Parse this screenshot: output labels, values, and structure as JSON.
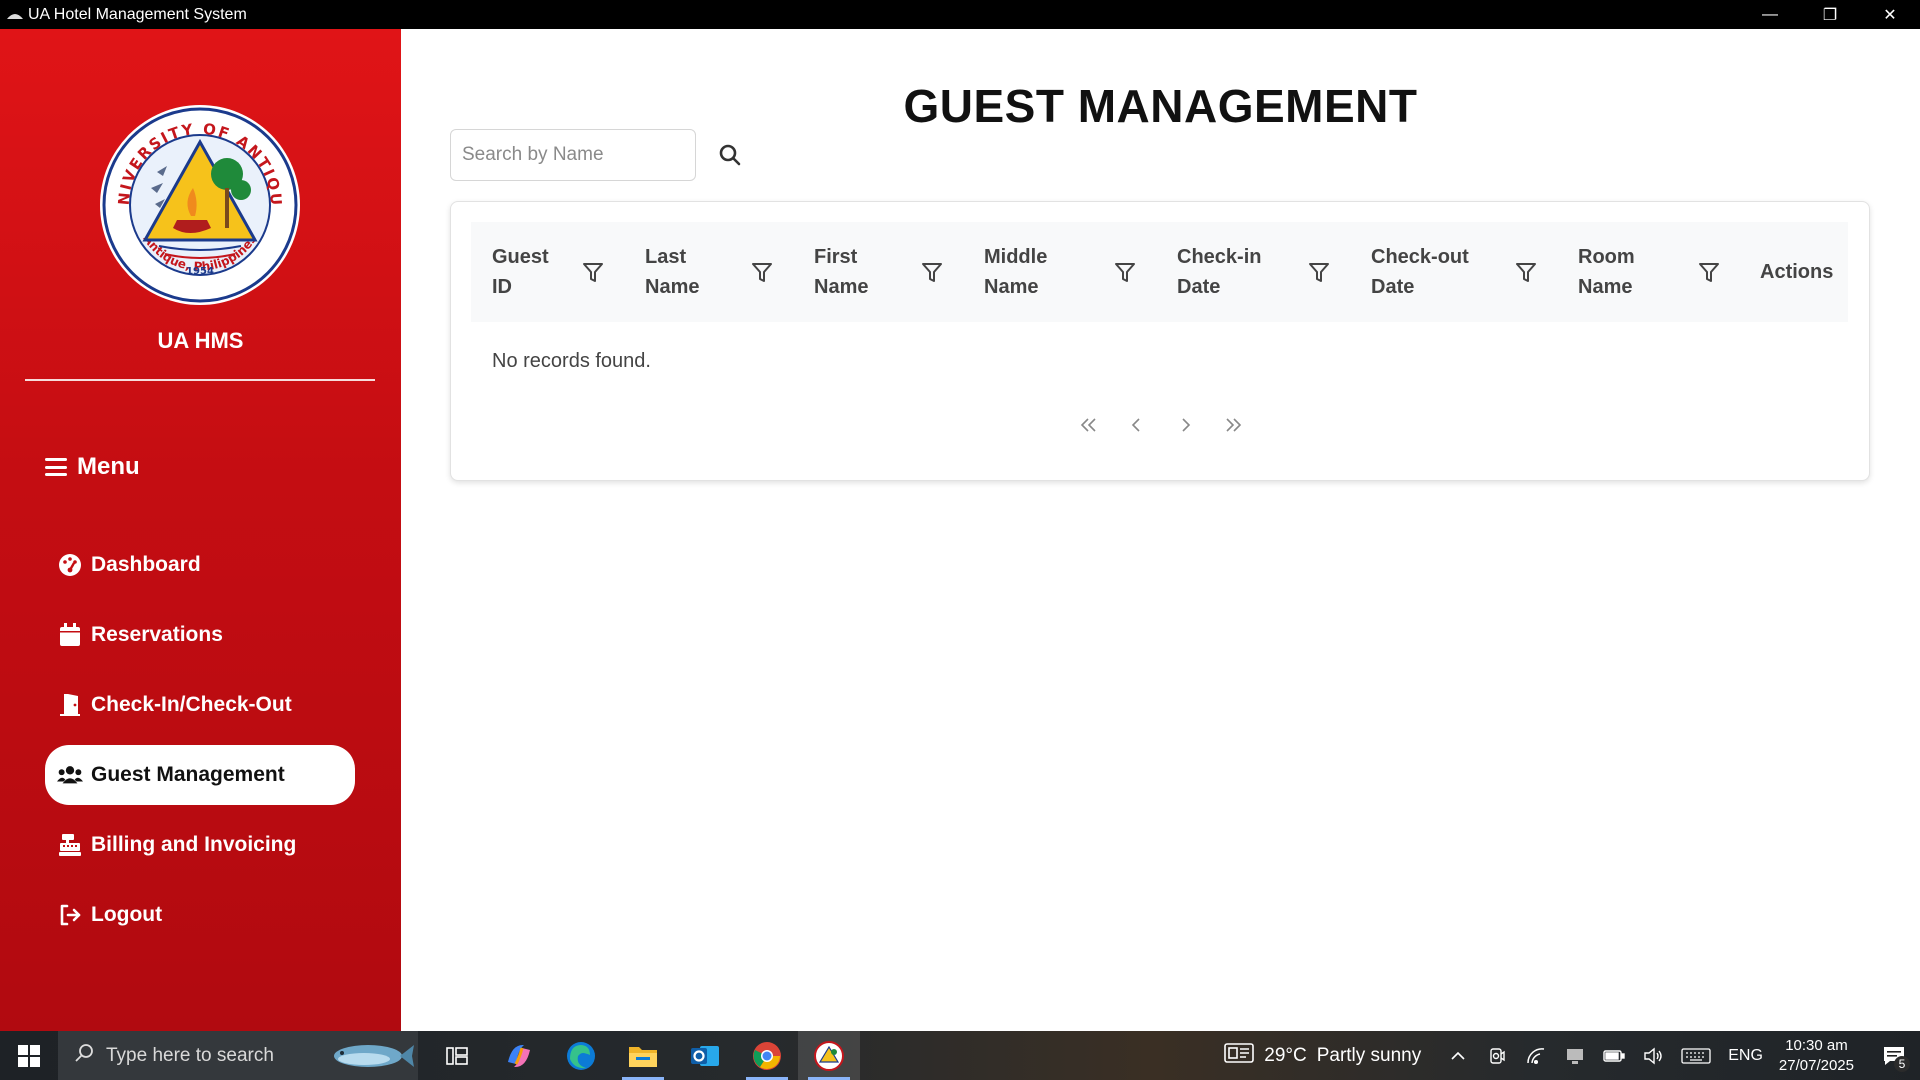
{
  "window": {
    "title": "UA Hotel Management System",
    "controls": {
      "minimize": "—",
      "maximize": "❐",
      "close": "✕"
    }
  },
  "sidebar": {
    "brand": "UA HMS",
    "logo_text": {
      "top": "UNIVERSITY OF ANTIQUE",
      "bottom": "Antique, Philippines",
      "year": "1954"
    },
    "menu_heading": "Menu",
    "items": [
      {
        "label": "Dashboard",
        "icon": "dashboard-icon",
        "active": false
      },
      {
        "label": "Reservations",
        "icon": "calendar-icon",
        "active": false
      },
      {
        "label": "Check-In/Check-Out",
        "icon": "door-icon",
        "active": false
      },
      {
        "label": "Guest Management",
        "icon": "users-icon",
        "active": true
      },
      {
        "label": "Billing and Invoicing",
        "icon": "cash-register-icon",
        "active": false
      },
      {
        "label": "Logout",
        "icon": "logout-icon",
        "active": false
      }
    ],
    "colors": {
      "primary": "#e01417",
      "dark": "#b10a10"
    }
  },
  "main": {
    "title": "GUEST MANAGEMENT",
    "search": {
      "placeholder": "Search by Name",
      "value": ""
    },
    "table": {
      "columns": [
        {
          "line1": "Guest",
          "line2": "ID",
          "filter": true
        },
        {
          "line1": "Last",
          "line2": "Name",
          "filter": true
        },
        {
          "line1": "First",
          "line2": "Name",
          "filter": true
        },
        {
          "line1": "Middle",
          "line2": "Name",
          "filter": true
        },
        {
          "line1": "Check-in",
          "line2": "Date",
          "filter": true
        },
        {
          "line1": "Check-out",
          "line2": "Date",
          "filter": true
        },
        {
          "line1": "Room",
          "line2": "Name",
          "filter": true
        },
        {
          "line1": "Actions",
          "line2": "",
          "filter": false
        }
      ],
      "empty_message": "No records found.",
      "pager": {
        "first": "«",
        "prev": "‹",
        "next": "›",
        "last": "»"
      }
    }
  },
  "taskbar": {
    "search_placeholder": "Type here to search",
    "apps": [
      "task-view-icon",
      "copilot-icon",
      "edge-icon",
      "file-explorer-icon",
      "outlook-icon",
      "chrome-icon",
      "ua-hms-app-icon"
    ],
    "weather": {
      "temp": "29°C",
      "condition": "Partly sunny"
    },
    "language": "ENG",
    "time": "10:30 am",
    "date": "27/07/2025",
    "notifications": "5"
  }
}
